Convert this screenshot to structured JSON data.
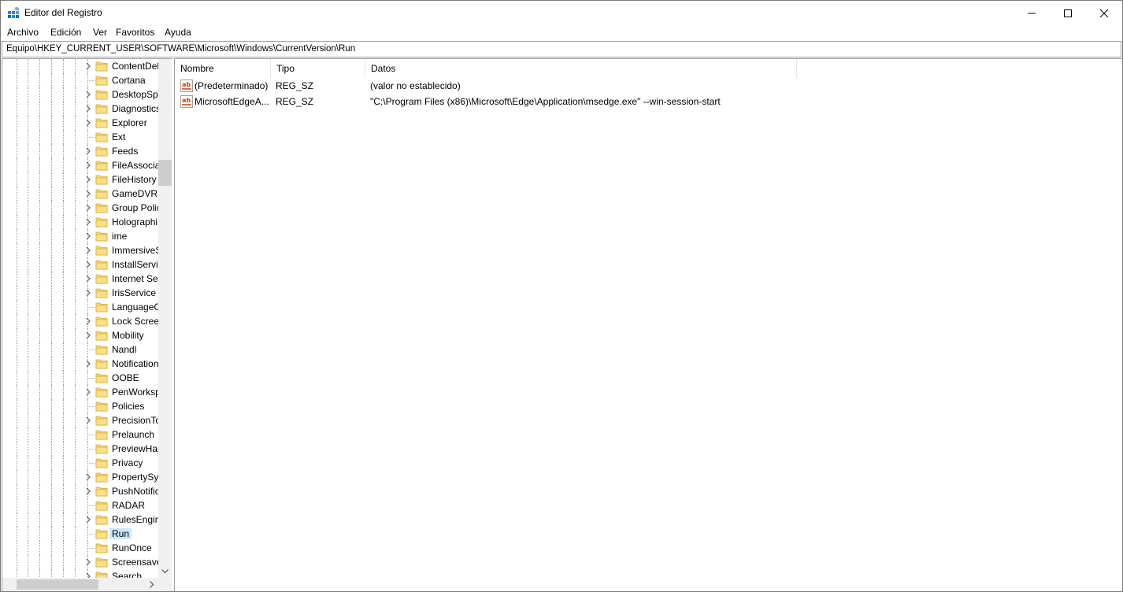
{
  "window": {
    "title": "Editor del Registro",
    "app_icon": "registry-editor-icon"
  },
  "menu": [
    {
      "label": "Archivo"
    },
    {
      "label": "Edición"
    },
    {
      "label": "Ver"
    },
    {
      "label": "Favoritos"
    },
    {
      "label": "Ayuda"
    }
  ],
  "address": {
    "path": "Equipo\\HKEY_CURRENT_USER\\SOFTWARE\\Microsoft\\Windows\\CurrentVersion\\Run"
  },
  "tree": {
    "items": [
      {
        "label": "ContentDel",
        "expandable": true
      },
      {
        "label": "Cortana",
        "expandable": false
      },
      {
        "label": "DesktopSpo",
        "expandable": true
      },
      {
        "label": "Diagnostics",
        "expandable": true
      },
      {
        "label": "Explorer",
        "expandable": true
      },
      {
        "label": "Ext",
        "expandable": false
      },
      {
        "label": "Feeds",
        "expandable": true
      },
      {
        "label": "FileAssocia",
        "expandable": true
      },
      {
        "label": "FileHistory",
        "expandable": true
      },
      {
        "label": "GameDVR",
        "expandable": true
      },
      {
        "label": "Group Polic",
        "expandable": true
      },
      {
        "label": "Holographi",
        "expandable": true
      },
      {
        "label": "ime",
        "expandable": true
      },
      {
        "label": "ImmersiveS",
        "expandable": true
      },
      {
        "label": "InstallServi",
        "expandable": true
      },
      {
        "label": "Internet Set",
        "expandable": true
      },
      {
        "label": "IrisService",
        "expandable": true
      },
      {
        "label": "LanguageC",
        "expandable": false
      },
      {
        "label": "Lock Screer",
        "expandable": true
      },
      {
        "label": "Mobility",
        "expandable": true
      },
      {
        "label": "Nandl",
        "expandable": false
      },
      {
        "label": "Notification",
        "expandable": true
      },
      {
        "label": "OOBE",
        "expandable": false
      },
      {
        "label": "PenWorksp",
        "expandable": true
      },
      {
        "label": "Policies",
        "expandable": false
      },
      {
        "label": "PrecisionTo",
        "expandable": true
      },
      {
        "label": "Prelaunch",
        "expandable": false
      },
      {
        "label": "PreviewHar",
        "expandable": false
      },
      {
        "label": "Privacy",
        "expandable": false
      },
      {
        "label": "PropertySys",
        "expandable": true
      },
      {
        "label": "PushNotific",
        "expandable": true
      },
      {
        "label": "RADAR",
        "expandable": false
      },
      {
        "label": "RulesEngin",
        "expandable": true
      },
      {
        "label": "Run",
        "expandable": false,
        "selected": true
      },
      {
        "label": "RunOnce",
        "expandable": false
      },
      {
        "label": "Screensave",
        "expandable": true
      },
      {
        "label": "Search",
        "expandable": true
      }
    ]
  },
  "list": {
    "columns": [
      {
        "label": "Nombre"
      },
      {
        "label": "Tipo"
      },
      {
        "label": "Datos"
      }
    ],
    "rows": [
      {
        "icon": "string-value-icon",
        "name": "(Predeterminado)",
        "type": "REG_SZ",
        "data": "(valor no establecido)"
      },
      {
        "icon": "string-value-icon",
        "name": "MicrosoftEdgeA...",
        "type": "REG_SZ",
        "data": "\"C:\\Program Files (x86)\\Microsoft\\Edge\\Application\\msedge.exe\" --win-session-start"
      }
    ]
  },
  "colors": {
    "selection": "#cce8ff",
    "folder": "#f8d775",
    "value_icon": "#d83b01"
  }
}
